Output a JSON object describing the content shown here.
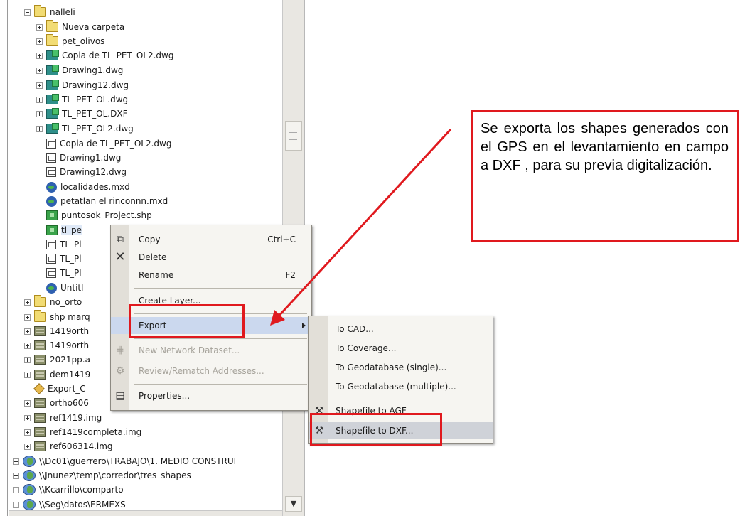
{
  "tree": {
    "items": [
      {
        "label": "nalleli",
        "expander": "minus",
        "icon": "folder"
      },
      {
        "label": "Nueva carpeta",
        "expander": "plus",
        "icon": "folder"
      },
      {
        "label": "pet_olivos",
        "expander": "plus",
        "icon": "folder"
      },
      {
        "label": "Copia de TL_PET_OL2.dwg",
        "expander": "plus",
        "icon": "cad"
      },
      {
        "label": "Drawing1.dwg",
        "expander": "plus",
        "icon": "cad"
      },
      {
        "label": "Drawing12.dwg",
        "expander": "plus",
        "icon": "cad"
      },
      {
        "label": "TL_PET_OL.dwg",
        "expander": "plus",
        "icon": "cad"
      },
      {
        "label": "TL_PET_OL.DXF",
        "expander": "plus",
        "icon": "cad"
      },
      {
        "label": "TL_PET_OL2.dwg",
        "expander": "plus",
        "icon": "cad"
      },
      {
        "label": "Copia de TL_PET_OL2.dwg",
        "expander": "none",
        "icon": "dwgsub"
      },
      {
        "label": "Drawing1.dwg",
        "expander": "none",
        "icon": "dwgsub"
      },
      {
        "label": "Drawing12.dwg",
        "expander": "none",
        "icon": "dwgsub"
      },
      {
        "label": "localidades.mxd",
        "expander": "none",
        "icon": "mxd"
      },
      {
        "label": "petatlan el rinconnn.mxd",
        "expander": "none",
        "icon": "mxd"
      },
      {
        "label": "puntosok_Project.shp",
        "expander": "none",
        "icon": "shp"
      },
      {
        "label": "tl_pe",
        "expander": "none",
        "icon": "shp"
      },
      {
        "label": "TL_Pl",
        "expander": "none",
        "icon": "dwgsub"
      },
      {
        "label": "TL_Pl",
        "expander": "none",
        "icon": "dwgsub"
      },
      {
        "label": "TL_Pl",
        "expander": "none",
        "icon": "dwgsub"
      },
      {
        "label": "Untitl",
        "expander": "none",
        "icon": "mxd"
      },
      {
        "label": "no_orto",
        "expander": "plus",
        "icon": "folder"
      },
      {
        "label": "shp marq",
        "expander": "plus",
        "icon": "folder"
      },
      {
        "label": "1419orth",
        "expander": "plus",
        "icon": "raster"
      },
      {
        "label": "1419orth",
        "expander": "plus",
        "icon": "raster"
      },
      {
        "label": "2021pp.a",
        "expander": "plus",
        "icon": "raster"
      },
      {
        "label": "dem1419",
        "expander": "plus",
        "icon": "raster"
      },
      {
        "label": "Export_C",
        "expander": "none",
        "icon": "diamond"
      },
      {
        "label": "ortho606",
        "expander": "plus",
        "icon": "raster"
      },
      {
        "label": "ref1419.img",
        "expander": "plus",
        "icon": "raster"
      },
      {
        "label": "ref1419completa.img",
        "expander": "plus",
        "icon": "raster"
      },
      {
        "label": "ref606314.img",
        "expander": "plus",
        "icon": "raster"
      },
      {
        "label": "\\\\Dc01\\guerrero\\TRABAJO\\1. MEDIO CONSTRUI",
        "expander": "plus",
        "icon": "globe"
      },
      {
        "label": "\\\\Jnunez\\temp\\corredor\\tres_shapes",
        "expander": "plus",
        "icon": "globe"
      },
      {
        "label": "\\\\Kcarrillo\\comparto",
        "expander": "plus",
        "icon": "globe"
      },
      {
        "label": "\\\\Seg\\datos\\ERMEXS",
        "expander": "plus",
        "icon": "globe"
      }
    ]
  },
  "context_menu": {
    "copy": {
      "label": "Copy",
      "shortcut": "Ctrl+C",
      "icon": "copy-icon"
    },
    "delete": {
      "label": "Delete",
      "icon": "delete-x-icon"
    },
    "rename": {
      "label": "Rename",
      "shortcut": "F2"
    },
    "create_layer": {
      "label": "Create Layer..."
    },
    "export": {
      "label": "Export"
    },
    "new_network": {
      "label": "New Network Dataset..."
    },
    "review_rematch": {
      "label": "Review/Rematch Addresses..."
    },
    "properties": {
      "label": "Properties..."
    }
  },
  "submenu": {
    "to_cad": "To CAD...",
    "to_coverage": "To Coverage...",
    "to_gdb_single": "To Geodatabase (single)...",
    "to_gdb_multiple": "To Geodatabase (multiple)...",
    "shp_to_agf": "Shapefile to AGF",
    "shp_to_dxf": "Shapefile to DXF..."
  },
  "callout": {
    "text": "Se exporta los shapes generados con el GPS en el levantamiento en campo a DXF , para su previa digitalización."
  },
  "colors": {
    "highlight_red": "#e0191e"
  }
}
